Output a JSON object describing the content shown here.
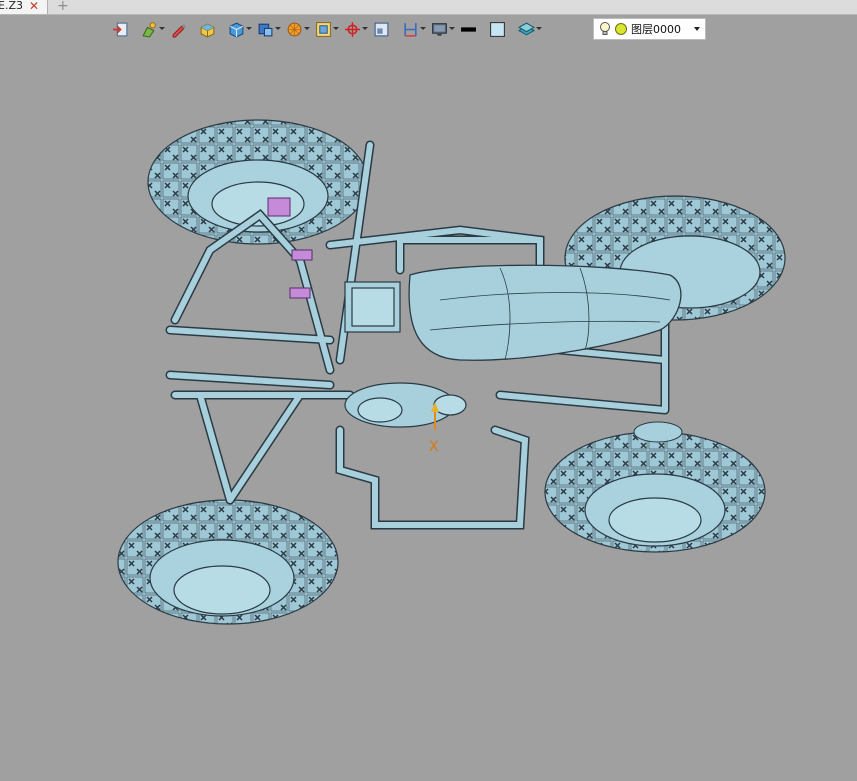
{
  "tab": {
    "label": "E.Z3",
    "close_glyph": "✕",
    "add_glyph": "+"
  },
  "toolbar": {
    "buttons": [
      {
        "icon": "import-icon"
      },
      {
        "icon": "paint-icon"
      },
      {
        "icon": "pen-icon"
      },
      {
        "icon": "cube-yellow-icon"
      },
      {
        "icon": "cube-blue-icon"
      },
      {
        "icon": "solid-icon"
      },
      {
        "icon": "sphere-orange-icon"
      },
      {
        "icon": "frame-icon"
      },
      {
        "icon": "pivot-icon"
      },
      {
        "icon": "window-icon"
      },
      {
        "icon": "dimension-icon"
      },
      {
        "icon": "display-icon"
      },
      {
        "icon": "line-style-icon"
      },
      {
        "icon": "color-swatch-icon"
      },
      {
        "icon": "layer-stack-icon"
      }
    ],
    "layer_selector": {
      "value": "图层0000"
    }
  },
  "viewport": {
    "axis_label": "X",
    "background": "#a0a0a0",
    "model_color": "#a8d0dc"
  }
}
